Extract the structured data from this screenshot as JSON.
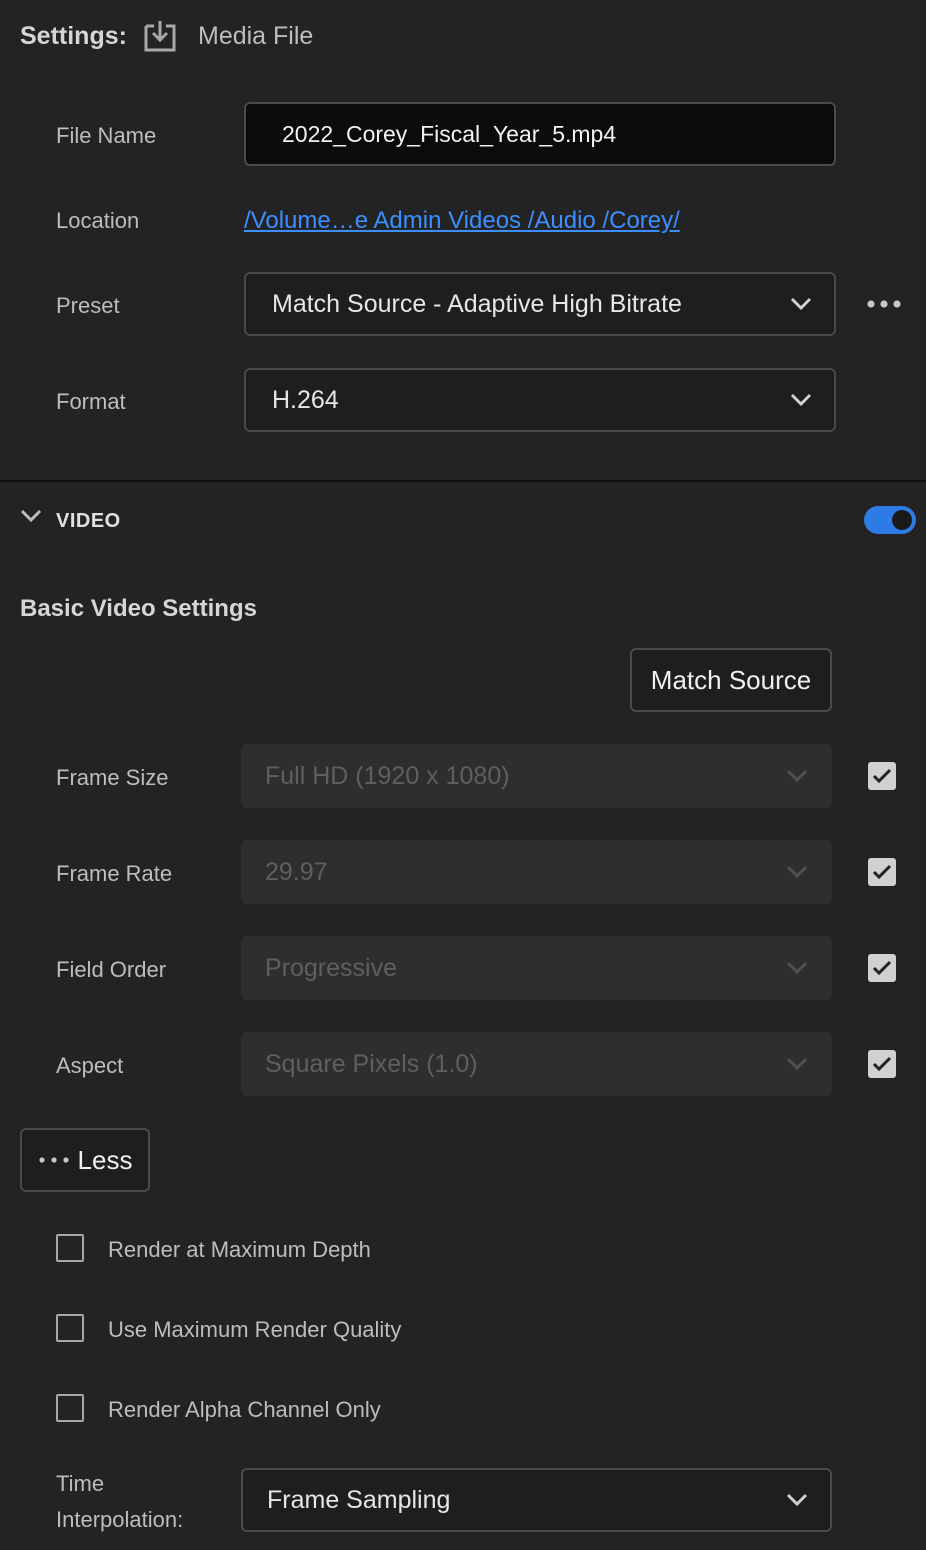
{
  "header": {
    "settings_label": "Settings:",
    "export_icon": "export-download-icon",
    "media_file_label": "Media File"
  },
  "file_name": {
    "label": "File Name",
    "value": "2022_Corey_Fiscal_Year_5.mp4"
  },
  "location": {
    "label": "Location",
    "path": "/Volume…e Admin Videos /Audio /Corey/"
  },
  "preset": {
    "label": "Preset",
    "value": "Match Source - Adaptive High Bitrate",
    "more_icon": "more-horizontal-icon"
  },
  "format": {
    "label": "Format",
    "value": "H.264"
  },
  "video_section": {
    "title": "VIDEO",
    "enabled": true,
    "accent_color": "#2d7be5",
    "basic_heading": "Basic Video Settings",
    "match_source_label": "Match Source",
    "fields": [
      {
        "label": "Frame Size",
        "value": "Full HD (1920 x 1080)",
        "match_source_checked": true
      },
      {
        "label": "Frame Rate",
        "value": "29.97",
        "match_source_checked": true
      },
      {
        "label": "Field Order",
        "value": "Progressive",
        "match_source_checked": true
      },
      {
        "label": "Aspect",
        "value": "Square Pixels (1.0)",
        "match_source_checked": true
      }
    ],
    "less_label": "Less",
    "options": [
      {
        "label": "Render at Maximum Depth",
        "checked": false
      },
      {
        "label": "Use Maximum Render Quality",
        "checked": false
      },
      {
        "label": "Render Alpha Channel Only",
        "checked": false
      }
    ],
    "time_interpolation": {
      "label": "Time Interpolation:",
      "value": "Frame Sampling"
    }
  }
}
